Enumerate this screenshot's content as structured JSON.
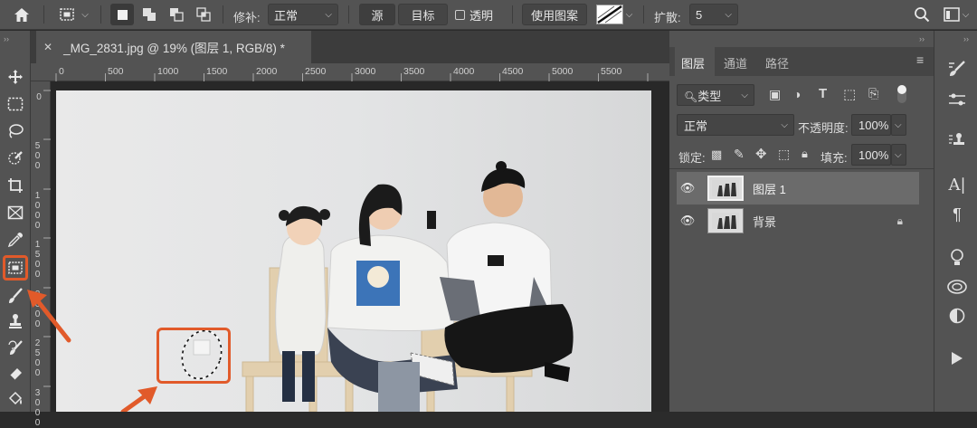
{
  "options_bar": {
    "home_icon": "home-icon",
    "tool_icon": "patch-tool-icon",
    "repair_label": "修补:",
    "repair_value": "正常",
    "source_btn": "源",
    "target_btn": "目标",
    "transparent_label": "透明",
    "use_pattern_btn": "使用图案",
    "diffusion_label": "扩散:",
    "diffusion_value": "5"
  },
  "document_tab": {
    "title": "_MG_2831.jpg @ 19% (图层 1, RGB/8) *"
  },
  "ruler": {
    "h_labels": [
      "0",
      "500",
      "1000",
      "1500",
      "2000",
      "2500",
      "3000",
      "3500",
      "4000",
      "4500",
      "5000",
      "5500"
    ],
    "v_labels": [
      "0",
      "500",
      "1000",
      "1500",
      "2000",
      "2500",
      "3000"
    ]
  },
  "layers_panel": {
    "tabs": [
      "图层",
      "通道",
      "路径"
    ],
    "filter_kind": "类型",
    "blend_mode": "正常",
    "opacity_label": "不透明度:",
    "opacity_value": "100%",
    "lock_label": "锁定:",
    "fill_label": "填充:",
    "fill_value": "100%",
    "layers": [
      {
        "name": "图层 1",
        "selected": true,
        "locked": false
      },
      {
        "name": "背景",
        "selected": false,
        "locked": true
      }
    ]
  },
  "colors": {
    "accent_highlight": "#e15a2a",
    "panel_bg": "#535353",
    "dark_bg": "#3c3c3c"
  }
}
